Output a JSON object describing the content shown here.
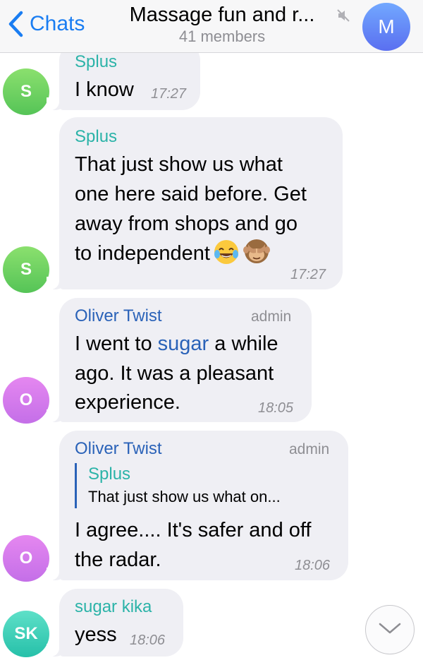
{
  "header": {
    "back_label": "Chats",
    "title": "Massage fun and r...",
    "subtitle": "41 members",
    "avatar_letter": "M"
  },
  "messages": [
    {
      "sender": "Splus",
      "avatar": "S",
      "lines": [
        "I know"
      ],
      "time": "17:27"
    },
    {
      "sender": "Splus",
      "avatar": "S",
      "lines": [
        "That just show us what",
        "one here said before. Get",
        "away from shops and go",
        "to independent"
      ],
      "emojis": [
        "face-with-tears-of-joy",
        "see-no-evil-monkey"
      ],
      "time": "17:27"
    },
    {
      "sender": "Oliver Twist",
      "role": "admin",
      "avatar": "O",
      "line1_before": "I went to ",
      "line1_link": "sugar",
      "line1_after": " a while",
      "line2": "ago. It was a pleasant",
      "line3": "experience.",
      "time": "18:05"
    },
    {
      "sender": "Oliver Twist",
      "role": "admin",
      "avatar": "O",
      "reply_name": "Splus",
      "reply_text": "That just show us what on...",
      "lines": [
        "I agree.... It's safer and off",
        "the radar."
      ],
      "time": "18:06"
    },
    {
      "sender": "sugar kika",
      "avatar": "SK",
      "lines": [
        "yess"
      ],
      "time": "18:06"
    }
  ],
  "colors": {
    "accent": "#1a7df2",
    "splus_name": "#2bb3a8",
    "oliver_name": "#2a62b8",
    "kika_name": "#2bb3a8",
    "bubble": "#efeff4"
  },
  "icons": {
    "back": "chevron-left-icon",
    "mute": "muted-speaker-icon",
    "scroll": "chevron-down-icon"
  }
}
